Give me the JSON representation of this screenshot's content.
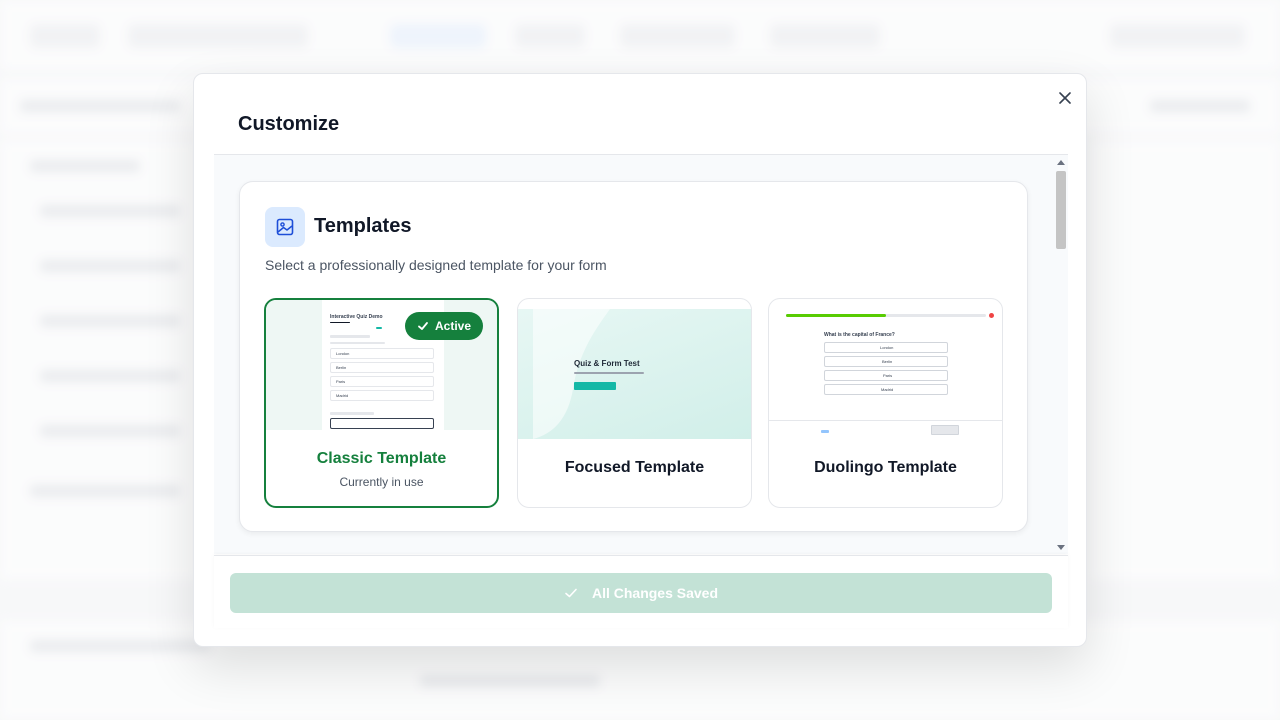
{
  "modal": {
    "title": "Customize",
    "close_icon": "close-icon"
  },
  "templates_section": {
    "icon": "image-icon",
    "title": "Templates",
    "description": "Select a professionally designed template for your form",
    "items": [
      {
        "name": "Classic Template",
        "subtitle": "Currently in use",
        "active": true,
        "badge": "Active",
        "preview": {
          "heading": "Interactive Quiz Demo",
          "options": [
            "London",
            "Berlin",
            "Paris",
            "Madrid"
          ]
        }
      },
      {
        "name": "Focused Template",
        "active": false,
        "preview": {
          "heading": "Quiz & Form Test"
        }
      },
      {
        "name": "Duolingo Template",
        "active": false,
        "preview": {
          "question": "What is the capital of France?",
          "options": [
            "London",
            "Berlin",
            "Paris",
            "Madrid"
          ]
        }
      }
    ]
  },
  "footer": {
    "save_label": "All Changes Saved",
    "save_icon": "check-icon"
  },
  "colors": {
    "accent_green": "#15803d",
    "icon_bg_blue": "#dbeafe",
    "saved_button_bg": "#c3e2d6",
    "teal": "#14b8a6"
  }
}
